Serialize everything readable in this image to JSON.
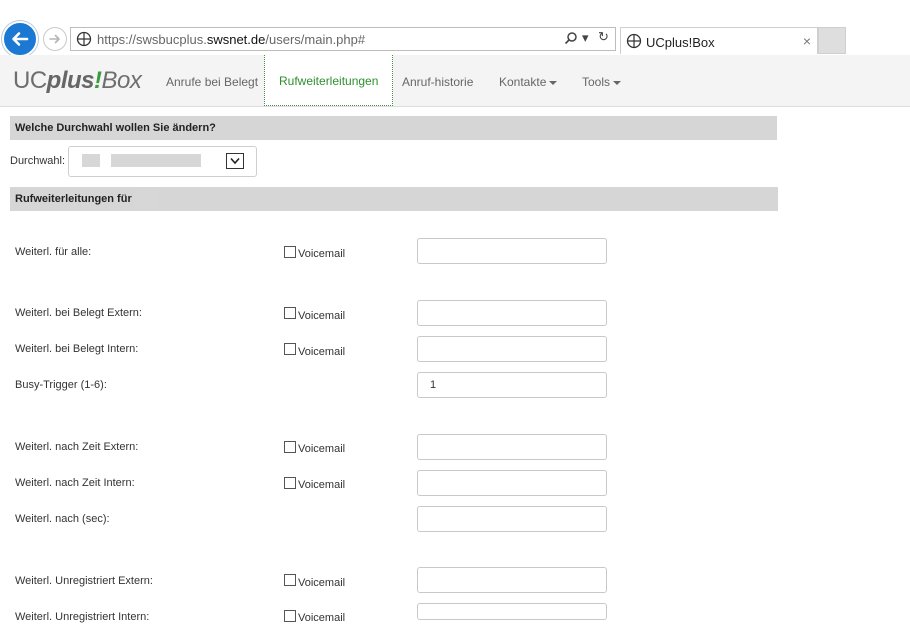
{
  "browser": {
    "url_prefix": "https://swsbucplus.",
    "url_domain": "swsnet.de",
    "url_path": "/users/main.php#",
    "tab_title": "UCplus!Box",
    "close_glyph": "×",
    "search_glyph": "⌕",
    "dropdown_glyph": "▾",
    "refresh_glyph": "↻"
  },
  "brand": {
    "uc": "UC",
    "plus": "plus",
    "excl": "!",
    "box": "Box"
  },
  "nav": {
    "items": [
      {
        "label": "Anrufe bei Belegt"
      },
      {
        "label": "Rufweiterleitungen"
      },
      {
        "label": "Anruf-historie"
      },
      {
        "label": "Kontakte"
      },
      {
        "label": "Tools"
      }
    ]
  },
  "colors": {
    "accent": "#2f8f2f",
    "back_button": "#1b78d3",
    "section_bg": "#d6d6d6"
  },
  "durchwahl": {
    "heading": "Welche Durchwahl wollen Sie ändern?",
    "label": "Durchwahl:"
  },
  "forwarding": {
    "heading": "Rufweiterleitungen für",
    "checkbox_label": "Voicemail",
    "rows": [
      {
        "label": "Weiterl. für alle:"
      },
      {
        "label": "Weiterl. bei Belegt Extern:"
      },
      {
        "label": "Weiterl. bei Belegt Intern:"
      },
      {
        "label": "Busy-Trigger (1-6):",
        "value": "1"
      },
      {
        "label": "Weiterl. nach Zeit Extern:"
      },
      {
        "label": "Weiterl. nach Zeit Intern:"
      },
      {
        "label": "Weiterl. nach (sec):"
      },
      {
        "label": "Weiterl. Unregistriert Extern:"
      },
      {
        "label": "Weiterl. Unregistriert Intern:"
      }
    ]
  }
}
